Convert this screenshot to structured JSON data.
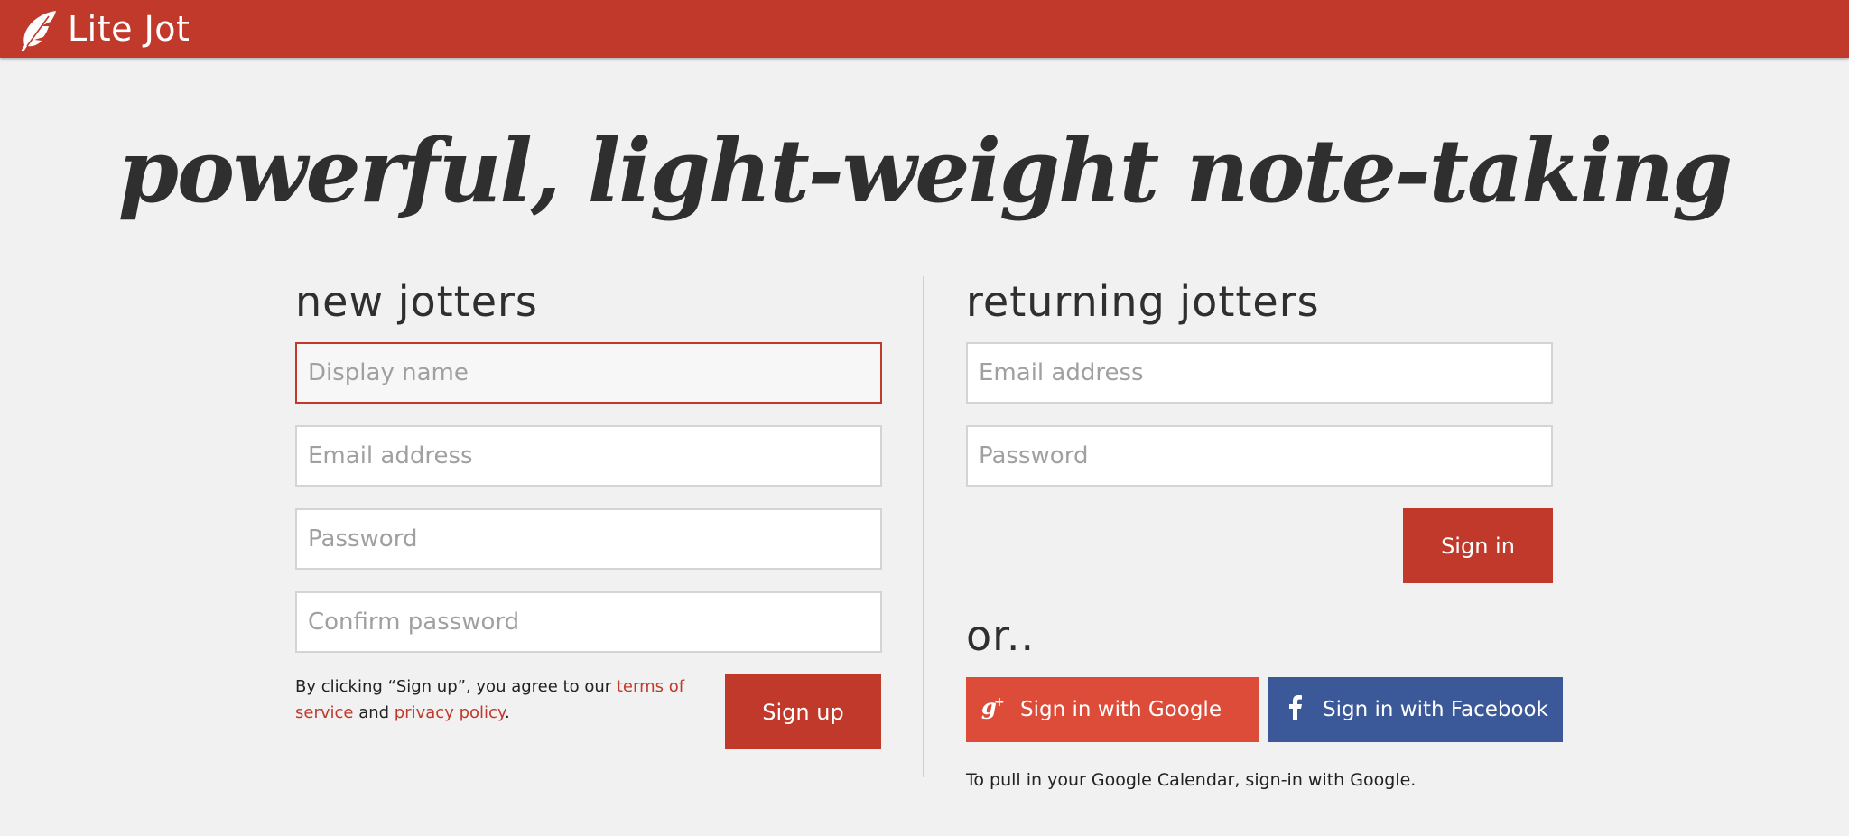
{
  "header": {
    "brand": "Lite Jot",
    "logo_icon": "feather-icon",
    "bar_color": "#c0392b"
  },
  "hero": {
    "title": "powerful, light-weight note-taking"
  },
  "new_jotters": {
    "heading": "new jotters",
    "fields": {
      "display_name": {
        "placeholder": "Display name",
        "value": ""
      },
      "email": {
        "placeholder": "Email address",
        "value": ""
      },
      "password": {
        "placeholder": "Password",
        "value": ""
      },
      "confirm_password": {
        "placeholder": "Confirm password",
        "value": ""
      }
    },
    "terms": {
      "prefix": "By clicking “Sign up”, you agree to our ",
      "terms_link": "terms of service",
      "middle": " and ",
      "privacy_link": "privacy policy",
      "suffix": "."
    },
    "signup_label": "Sign up"
  },
  "returning_jotters": {
    "heading": "returning jotters",
    "fields": {
      "email": {
        "placeholder": "Email address",
        "value": ""
      },
      "password": {
        "placeholder": "Password",
        "value": ""
      }
    },
    "signin_label": "Sign in",
    "or_text": "or..",
    "google": {
      "label": "Sign in with Google",
      "icon": "google-plus-icon",
      "color": "#dd4b39"
    },
    "facebook": {
      "label": "Sign in with Facebook",
      "icon": "facebook-icon",
      "color": "#3b5998"
    },
    "calendar_note": "To pull in your Google Calendar, sign-in with Google."
  },
  "colors": {
    "accent": "#c0392b",
    "background": "#f1f1f1",
    "text": "#2f2f2f"
  }
}
